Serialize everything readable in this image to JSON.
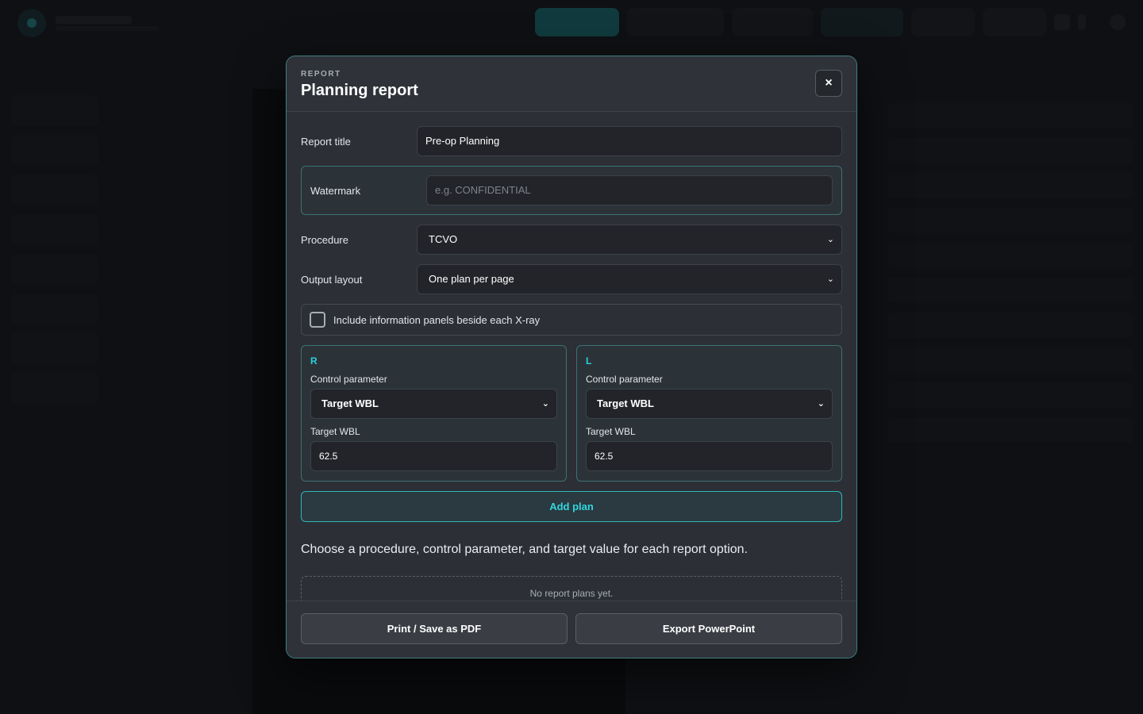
{
  "modal": {
    "eyebrow": "REPORT",
    "title": "Planning report",
    "close_label": "×",
    "fields": {
      "report_title_label": "Report title",
      "report_title_value": "Pre-op Planning",
      "watermark_label": "Watermark",
      "watermark_placeholder": "e.g. CONFIDENTIAL",
      "procedure_label": "Procedure",
      "procedure_value": "TCVO",
      "output_layout_label": "Output layout",
      "output_layout_value": "One plan per page",
      "include_panels_label": "Include information panels beside each X-ray",
      "include_panels_checked": false
    },
    "sides": [
      {
        "tag": "R",
        "control_label": "Control parameter",
        "control_value": "Target WBL",
        "target_label": "Target WBL",
        "target_value": "62.5"
      },
      {
        "tag": "L",
        "control_label": "Control parameter",
        "control_value": "Target WBL",
        "target_label": "Target WBL",
        "target_value": "62.5"
      }
    ],
    "add_plan_label": "Add plan",
    "help_text": "Choose a procedure, control parameter, and target value for each report option.",
    "empty_text": "No report plans yet.",
    "footer": {
      "print_label": "Print / Save as PDF",
      "export_label": "Export PowerPoint"
    }
  },
  "colors": {
    "accent": "#27d2db",
    "modal_border": "#3f7f82",
    "modal_bg": "#2c2f36"
  },
  "icons": {
    "close": "close-icon",
    "chevron": "chevron-down-icon"
  }
}
